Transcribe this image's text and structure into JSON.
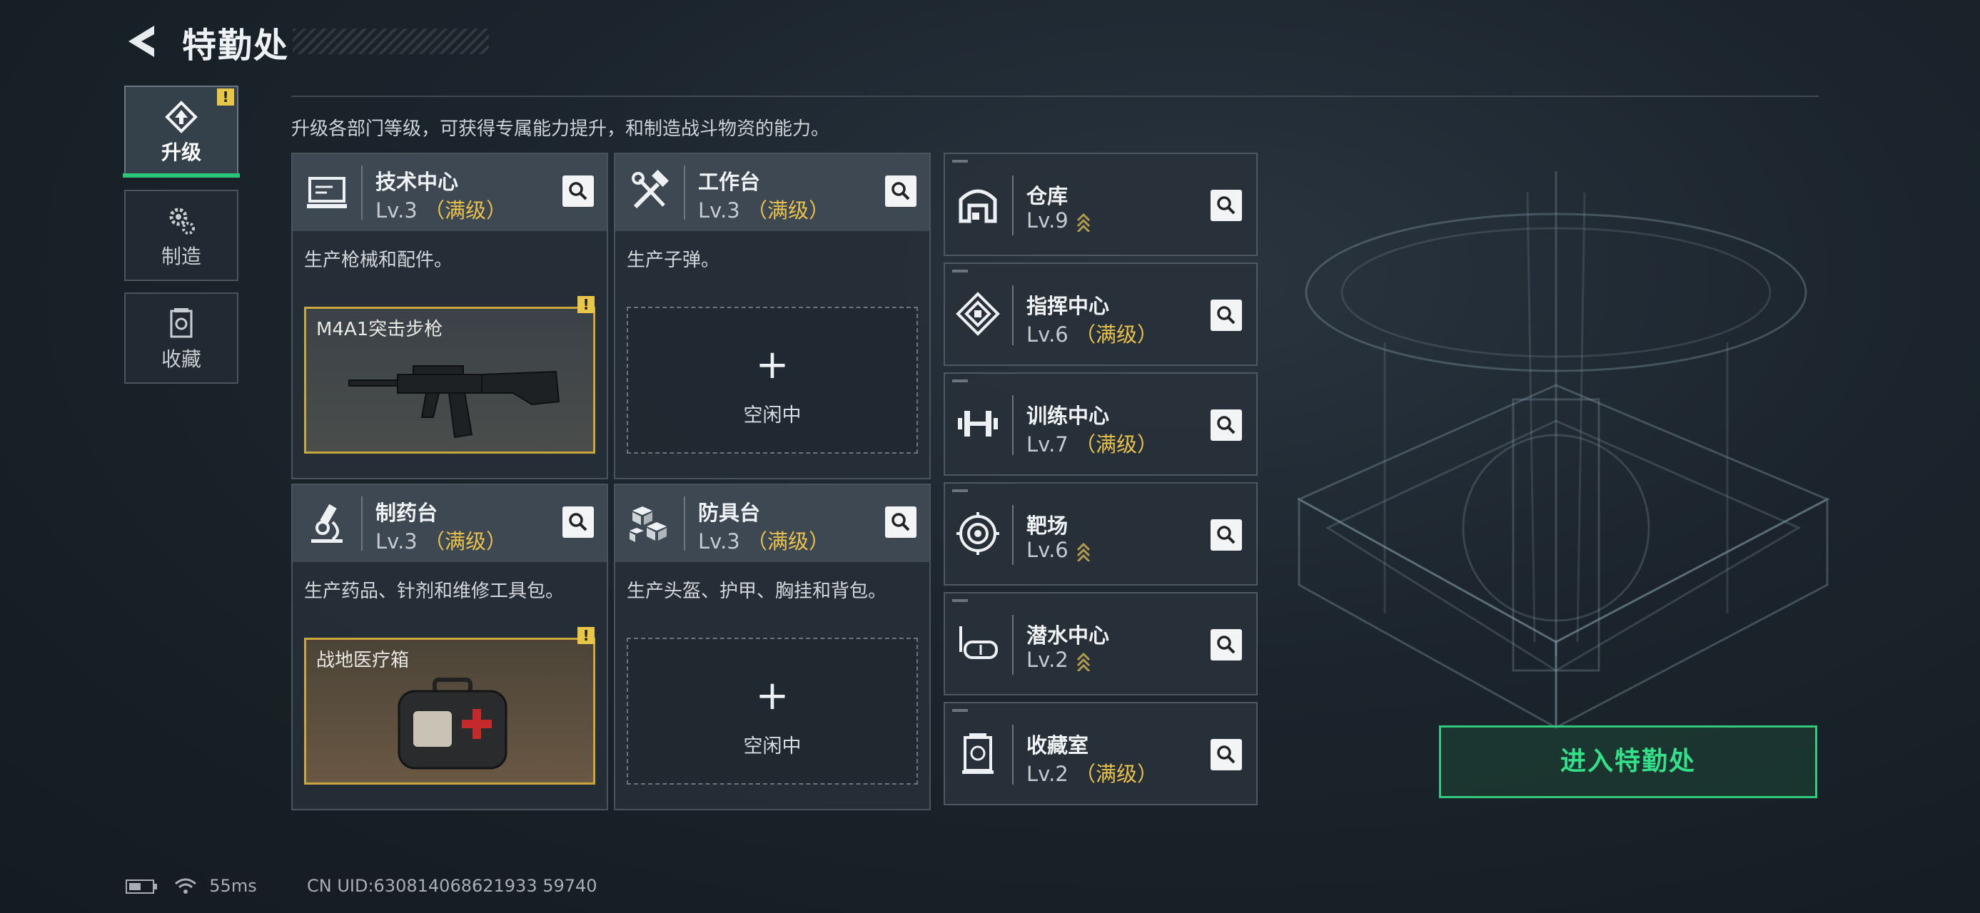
{
  "header": {
    "title": "特勤处"
  },
  "nav": [
    {
      "label": "升级",
      "active": true,
      "icon": "upgrade-icon",
      "warning": "!"
    },
    {
      "label": "制造",
      "active": false,
      "icon": "gears-icon"
    },
    {
      "label": "收藏",
      "active": false,
      "icon": "collection-icon"
    }
  ],
  "description": "升级各部门等级，可获得专属能力提升，和制造战斗物资的能力。",
  "cards": [
    {
      "name": "技术中心",
      "level": "Lv.3",
      "maxed": "（满级）",
      "desc": "生产枪械和配件。",
      "item": "M4A1突击步枪",
      "warning": "!",
      "icon": "computer-icon"
    },
    {
      "name": "工作台",
      "level": "Lv.3",
      "maxed": "（满级）",
      "desc": "生产子弹。",
      "slot": "空闲中",
      "plus": "+",
      "icon": "tools-icon"
    },
    {
      "name": "制药台",
      "level": "Lv.3",
      "maxed": "（满级）",
      "desc": "生产药品、针剂和维修工具包。",
      "item": "战地医疗箱",
      "warning": "!",
      "icon": "microscope-icon"
    },
    {
      "name": "防具台",
      "level": "Lv.3",
      "maxed": "（满级）",
      "desc": "生产头盔、护甲、胸挂和背包。",
      "slot": "空闲中",
      "plus": "+",
      "icon": "armor-boxes-icon"
    }
  ],
  "rooms": [
    {
      "name": "仓库",
      "level": "Lv.9",
      "maxed": "",
      "upgradable": true,
      "icon": "warehouse-icon"
    },
    {
      "name": "指挥中心",
      "level": "Lv.6",
      "maxed": "（满级）",
      "upgradable": false,
      "icon": "command-icon"
    },
    {
      "name": "训练中心",
      "level": "Lv.7",
      "maxed": "（满级）",
      "upgradable": false,
      "icon": "dumbbell-icon"
    },
    {
      "name": "靶场",
      "level": "Lv.6",
      "maxed": "",
      "upgradable": true,
      "icon": "target-icon"
    },
    {
      "name": "潜水中心",
      "level": "Lv.2",
      "maxed": "",
      "upgradable": true,
      "icon": "diving-mask-icon"
    },
    {
      "name": "收藏室",
      "level": "Lv.2",
      "maxed": "（满级）",
      "upgradable": false,
      "icon": "collection-room-icon"
    }
  ],
  "enter_button": "进入特勤处",
  "status": {
    "ping": "55ms",
    "uid": "CN UID:630814068621933 59740"
  },
  "colors": {
    "accent_green": "#2fca7c",
    "gold": "#e8c14c",
    "warning": "#e7c648"
  }
}
